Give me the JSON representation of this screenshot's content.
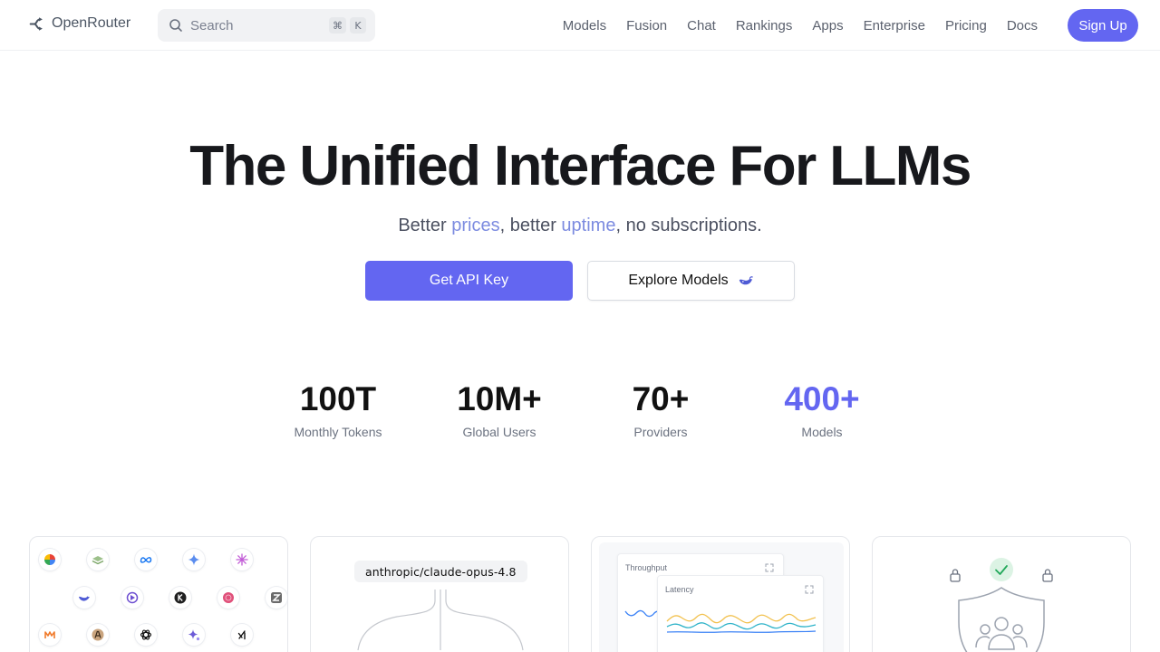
{
  "nav": {
    "logo_text": "OpenRouter",
    "search": {
      "placeholder": "Search",
      "shortcut_mod": "⌘",
      "shortcut_key": "K"
    },
    "links": [
      "Models",
      "Fusion",
      "Chat",
      "Rankings",
      "Apps",
      "Enterprise",
      "Pricing",
      "Docs"
    ],
    "signup_label": "Sign Up"
  },
  "hero": {
    "title": "The Unified Interface For LLMs",
    "subtitle": {
      "part1": "Better ",
      "link1": "prices",
      "part2": ", better ",
      "link2": "uptime",
      "part3": ", no subscriptions."
    },
    "primary_button": "Get API Key",
    "secondary_button": "Explore Models"
  },
  "stats": [
    {
      "value": "100T",
      "label": "Monthly Tokens",
      "accent": false
    },
    {
      "value": "10M+",
      "label": "Global Users",
      "accent": false
    },
    {
      "value": "70+",
      "label": "Providers",
      "accent": false
    },
    {
      "value": "400+",
      "label": "Models",
      "accent": true
    }
  ],
  "cards": {
    "routing": {
      "model_name": "anthropic/claude-opus-4.8"
    },
    "performance": {
      "throughput_label": "Throughput",
      "latency_label": "Latency"
    }
  },
  "colors": {
    "accent": "#6366f1",
    "link": "#7c8be0",
    "line_yellow": "#f2c14e",
    "line_teal": "#2eb3c9",
    "line_blue": "#3b82f6",
    "check_green": "#22a85a"
  }
}
